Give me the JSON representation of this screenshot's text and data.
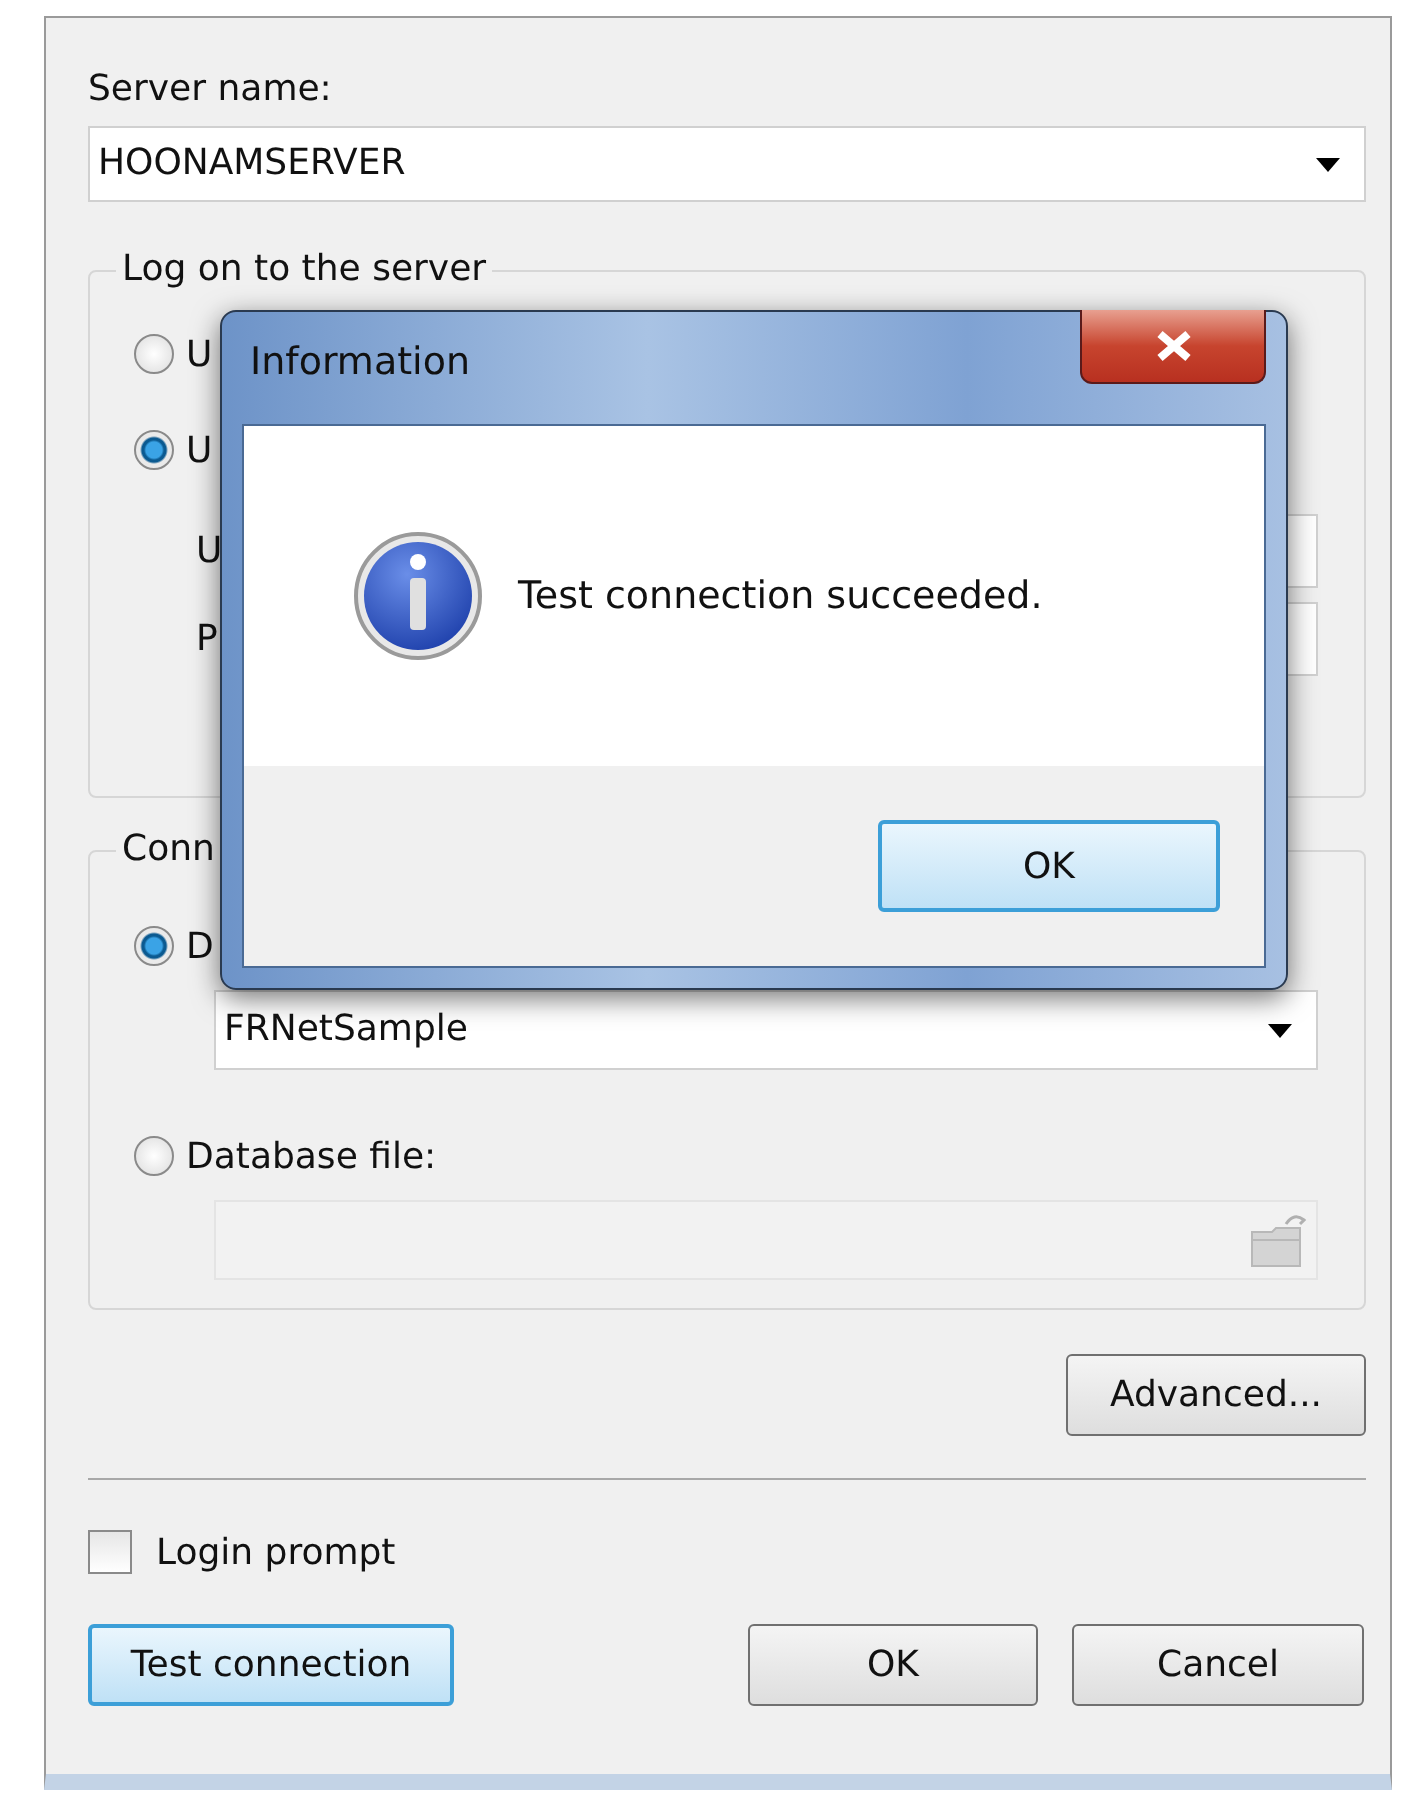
{
  "dialog": {
    "server_name": {
      "label": "Server name:",
      "value": "HOONAMSERVER"
    },
    "logon_group": {
      "title": "Log on to the server",
      "options": [
        {
          "label": "U",
          "selected": false
        },
        {
          "label": "U",
          "selected": true
        }
      ],
      "fields": [
        {
          "label": "U"
        },
        {
          "label": "P"
        }
      ]
    },
    "connection_group": {
      "title": "Conn",
      "options": [
        {
          "kind": "combo",
          "label": "D",
          "selected": true,
          "value": "FRNetSample",
          "disabled": false
        },
        {
          "kind": "file",
          "label": "Database file:",
          "selected": false,
          "disabled": true
        }
      ]
    },
    "advanced_button": "Advanced...",
    "login_prompt": {
      "label": "Login prompt",
      "checked": false
    },
    "buttons": [
      {
        "label": "Test connection",
        "focused": true
      },
      {
        "label": "OK",
        "focused": false
      },
      {
        "label": "Cancel",
        "focused": false
      }
    ]
  },
  "message_box": {
    "title": "Information",
    "message": "Test connection succeeded.",
    "button": {
      "label": "OK",
      "focused": true
    }
  }
}
